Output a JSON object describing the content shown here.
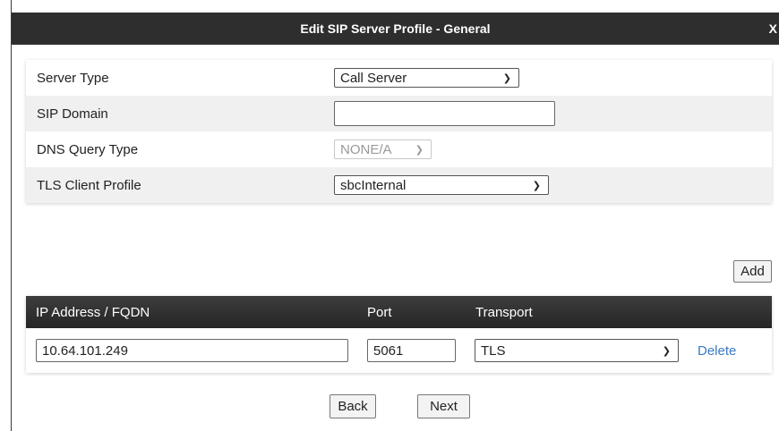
{
  "dialog": {
    "title": "Edit SIP Server Profile - General",
    "close_label": "X"
  },
  "form": {
    "server_type": {
      "label": "Server Type",
      "value": "Call Server"
    },
    "sip_domain": {
      "label": "SIP Domain",
      "value": ""
    },
    "dns_query_type": {
      "label": "DNS Query Type",
      "value": "NONE/A",
      "disabled": true
    },
    "tls_client_profile": {
      "label": "TLS Client Profile",
      "value": "sbcInternal"
    }
  },
  "add_button": "Add",
  "table": {
    "headers": [
      "IP Address / FQDN",
      "Port",
      "Transport"
    ],
    "rows": [
      {
        "ip": "10.64.101.249",
        "port": "5061",
        "transport": "TLS",
        "action": "Delete"
      }
    ]
  },
  "footer": {
    "back": "Back",
    "next": "Next"
  },
  "icons": {
    "dropdown": "chevron-down-icon"
  },
  "colors": {
    "titlebar": "#2e2e2e",
    "link": "#3a79c4",
    "alt_row": "#f0f0f0"
  }
}
